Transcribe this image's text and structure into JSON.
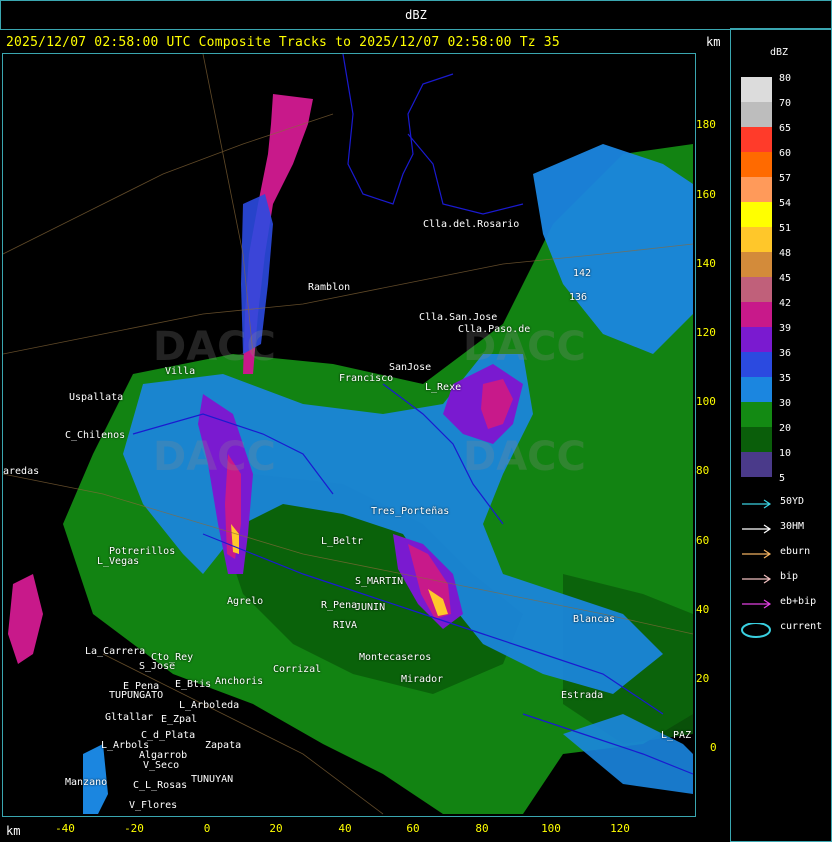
{
  "header": {
    "title": "dBZ"
  },
  "subtitle": "2025/12/07 02:58:00 UTC Composite Tracks to 2025/12/07 02:58:00 Tz 35",
  "axis": {
    "unit_top": "km",
    "unit_bottom": "km",
    "y_ticks": [
      "180",
      "160",
      "140",
      "120",
      "100",
      "80",
      "60",
      "40",
      "20",
      "0"
    ],
    "x_ticks": [
      "-40",
      "-20",
      "0",
      "20",
      "40",
      "60",
      "80",
      "100",
      "120"
    ]
  },
  "legend": {
    "title": "dBZ",
    "scale": [
      {
        "label": "80",
        "color": "#dcdcdc"
      },
      {
        "label": "70",
        "color": "#bdbdbd"
      },
      {
        "label": "65",
        "color": "#ff3b2a"
      },
      {
        "label": "60",
        "color": "#ff6a00"
      },
      {
        "label": "57",
        "color": "#ff9a5a"
      },
      {
        "label": "54",
        "color": "#ffff00"
      },
      {
        "label": "51",
        "color": "#ffc72a"
      },
      {
        "label": "48",
        "color": "#d38b3a"
      },
      {
        "label": "45",
        "color": "#c0607a"
      },
      {
        "label": "42",
        "color": "#c8198a"
      },
      {
        "label": "39",
        "color": "#7a1ad0"
      },
      {
        "label": "36",
        "color": "#2b4ae0"
      },
      {
        "label": "35",
        "color": "#1b86e0"
      },
      {
        "label": "30",
        "color": "#138a13"
      },
      {
        "label": "20",
        "color": "#0a5e0a"
      },
      {
        "label": "10",
        "color": "#4a3a8a"
      },
      {
        "label": "5",
        "color": "#000000"
      }
    ],
    "tracks": [
      {
        "label": "50YD",
        "color": "#3ad0e0",
        "type": "arrow"
      },
      {
        "label": "30HM",
        "color": "#ffffff",
        "type": "arrow"
      },
      {
        "label": "eburn",
        "color": "#f0b060",
        "type": "arrow"
      },
      {
        "label": "bip",
        "color": "#f0c0c0",
        "type": "arrow"
      },
      {
        "label": "eb+bip",
        "color": "#e040e0",
        "type": "arrow"
      },
      {
        "label": "current",
        "color": "#3ad0e0",
        "type": "ellipse"
      }
    ]
  },
  "places": [
    {
      "name": "Clla.del.Rosario"
    },
    {
      "name": "Ramblon"
    },
    {
      "name": "Clla.San.Jose"
    },
    {
      "name": "Clla.Paso.de"
    },
    {
      "name": "Villa"
    },
    {
      "name": "Uspallata"
    },
    {
      "name": "Francisco"
    },
    {
      "name": "SanJose"
    },
    {
      "name": "L_Rexe"
    },
    {
      "name": "C_Chilenos"
    },
    {
      "name": "aredas"
    },
    {
      "name": "L_Beltr"
    },
    {
      "name": "S_MARTIN"
    },
    {
      "name": "JUNIN"
    },
    {
      "name": "RIVA"
    },
    {
      "name": "Potrerillos"
    },
    {
      "name": "L_Vegas"
    },
    {
      "name": "R_Pena"
    },
    {
      "name": "Agrelo"
    },
    {
      "name": "La_Carrera"
    },
    {
      "name": "S_Jose"
    },
    {
      "name": "Cto_Rey"
    },
    {
      "name": "E_Pena"
    },
    {
      "name": "E_Btis"
    },
    {
      "name": "TUPUNGATO"
    },
    {
      "name": "Anchoris"
    },
    {
      "name": "L_Arboleda"
    },
    {
      "name": "Gltallar"
    },
    {
      "name": "E_Zpal"
    },
    {
      "name": "C_d_Plata"
    },
    {
      "name": "L_Arbols"
    },
    {
      "name": "Zapata"
    },
    {
      "name": "Algarrob"
    },
    {
      "name": "V_Seco"
    },
    {
      "name": "TUNUYAN"
    },
    {
      "name": "Manzano"
    },
    {
      "name": "C_L_Rosas"
    },
    {
      "name": "V_Flores"
    },
    {
      "name": "Corrizal"
    },
    {
      "name": "Montecaseros"
    },
    {
      "name": "Mirador"
    },
    {
      "name": "Tres_Porteñas"
    },
    {
      "name": "Blancas"
    },
    {
      "name": "L_PAZ"
    },
    {
      "name": "Estrada"
    },
    {
      "name": "142"
    },
    {
      "name": "136"
    }
  ]
}
